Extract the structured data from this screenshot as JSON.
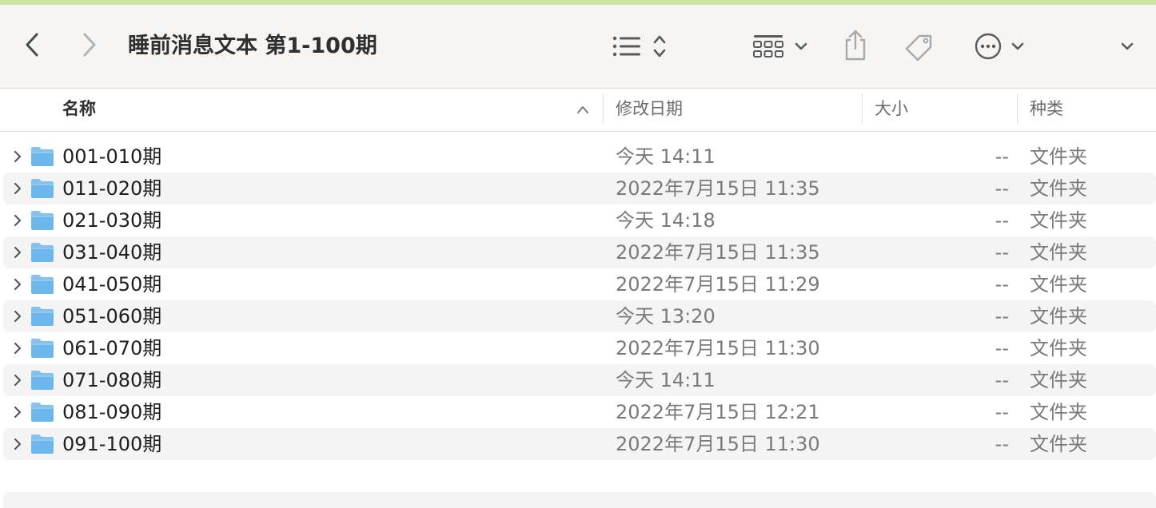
{
  "window": {
    "title": "睡前消息文本 第1-100期"
  },
  "toolbar": {
    "icons": [
      "chevron-left-icon",
      "chevron-right-icon",
      "list-view-icon",
      "sort-updown-icon",
      "grid-view-icon",
      "chevron-down-icon",
      "share-icon",
      "tag-icon",
      "more-icon",
      "chevron-down-icon",
      "chevron-down-icon"
    ]
  },
  "columns": {
    "name": "名称",
    "date": "修改日期",
    "size": "大小",
    "kind": "种类"
  },
  "rows": [
    {
      "name": "001-010期",
      "date": "今天 14:11",
      "size": "--",
      "kind": "文件夹"
    },
    {
      "name": "011-020期",
      "date": "2022年7月15日 11:35",
      "size": "--",
      "kind": "文件夹"
    },
    {
      "name": "021-030期",
      "date": "今天 14:18",
      "size": "--",
      "kind": "文件夹"
    },
    {
      "name": "031-040期",
      "date": "2022年7月15日 11:35",
      "size": "--",
      "kind": "文件夹"
    },
    {
      "name": "041-050期",
      "date": "2022年7月15日 11:29",
      "size": "--",
      "kind": "文件夹"
    },
    {
      "name": "051-060期",
      "date": "今天 13:20",
      "size": "--",
      "kind": "文件夹"
    },
    {
      "name": "061-070期",
      "date": "2022年7月15日 11:30",
      "size": "--",
      "kind": "文件夹"
    },
    {
      "name": "071-080期",
      "date": "今天 14:11",
      "size": "--",
      "kind": "文件夹"
    },
    {
      "name": "081-090期",
      "date": "2022年7月15日 12:21",
      "size": "--",
      "kind": "文件夹"
    },
    {
      "name": "091-100期",
      "date": "2022年7月15日 11:30",
      "size": "--",
      "kind": "文件夹"
    }
  ],
  "colors": {
    "folder": "#6cb8ec",
    "accent_top": "#cfe2a6"
  }
}
